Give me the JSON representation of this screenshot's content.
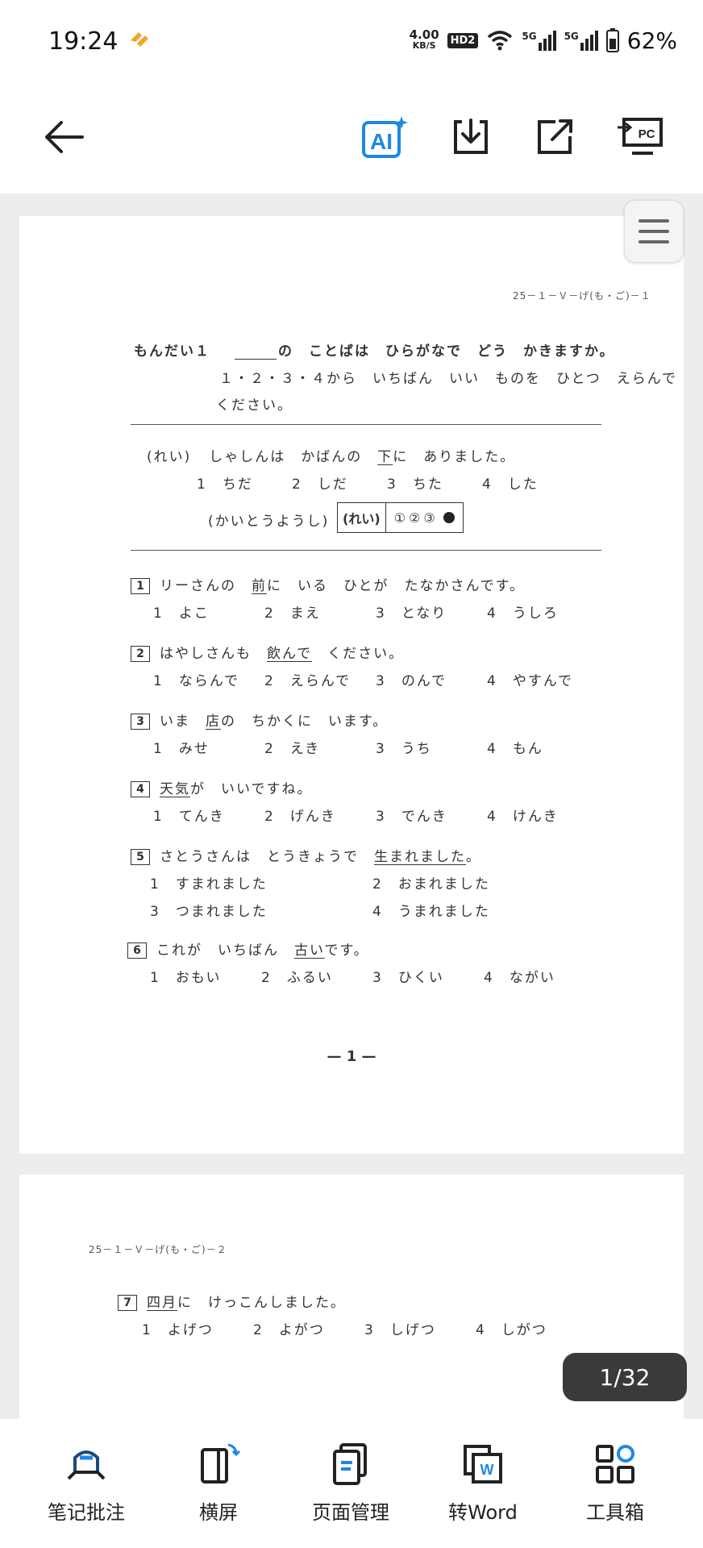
{
  "status_bar": {
    "time": "19:24",
    "speed_value": "4.00",
    "speed_unit": "KB/S",
    "hd_badge": "HD2",
    "network1": "5G",
    "network2": "5G",
    "battery": "62%"
  },
  "toolbar": {
    "back": "back-arrow-icon",
    "ai": "ai-icon",
    "download": "download-icon",
    "share": "share-icon",
    "to_pc": "PC"
  },
  "colors": {
    "accent": "#1e88e5",
    "ai_blue": "#1e88e5",
    "heart": "#f5a623"
  },
  "page1": {
    "code": "25－１－Ｖ－げ(も・ご)－１",
    "header_title": "もんだい１",
    "header_line1": "の　ことばは　ひらがなで　どう　かきますか。",
    "header_line2": "１・２・３・４から　いちばん　いい　ものを　ひとつ　えらんで",
    "header_line3": "ください。",
    "example": {
      "label": "(れい)",
      "sentence_pre": "しゃしんは　かばんの　",
      "sentence_u": "下",
      "sentence_post": "に　ありました。",
      "options": [
        "1　ちだ",
        "2　しだ",
        "3　ちた",
        "4　した"
      ],
      "answer_label": "(かいとうようし)",
      "answer_box_label": "(れい)",
      "answer_circles": "①②③"
    },
    "questions": [
      {
        "num": "1",
        "pre": "リーさんの　",
        "u": "前",
        "post": "に　いる　ひとが　たなかさんです。",
        "options": [
          "1　よこ",
          "2　まえ",
          "3　となり",
          "4　うしろ"
        ]
      },
      {
        "num": "2",
        "pre": "はやしさんも　",
        "u": "飲んで",
        "post": "　ください。",
        "options": [
          "1　ならんで",
          "2　えらんで",
          "3　のんで",
          "4　やすんで"
        ]
      },
      {
        "num": "3",
        "pre": "いま　",
        "u": "店",
        "post": "の　ちかくに　います。",
        "options": [
          "1　みせ",
          "2　えき",
          "3　うち",
          "4　もん"
        ]
      },
      {
        "num": "4",
        "pre": "",
        "u": "天気",
        "post": "が　いいですね。",
        "options": [
          "1　てんき",
          "2　げんき",
          "3　でんき",
          "4　けんき"
        ]
      },
      {
        "num": "5",
        "pre": "さとうさんは　とうきょうで　",
        "u": "生まれました",
        "post": "。",
        "options": [
          "1　すまれました",
          "2　おまれました",
          "3　つまれました",
          "4　うまれました"
        ]
      },
      {
        "num": "6",
        "pre": "これが　いちばん　",
        "u": "古い",
        "post": "です。",
        "options": [
          "1　おもい",
          "2　ふるい",
          "3　ひくい",
          "4　ながい"
        ]
      }
    ],
    "page_number": "— 1 —"
  },
  "page2": {
    "code": "25－１－Ｖ－げ(も・ご)－２",
    "question": {
      "num": "7",
      "pre": "",
      "u": "四月",
      "post": "に　けっこんしました。",
      "options": [
        "1　よげつ",
        "2　よがつ",
        "3　しげつ",
        "4　しがつ"
      ]
    }
  },
  "page_indicator": "1/32",
  "bottom_bar": {
    "items": [
      {
        "label": "笔记批注",
        "icon": "annotate-icon"
      },
      {
        "label": "横屏",
        "icon": "landscape-icon"
      },
      {
        "label": "页面管理",
        "icon": "page-manage-icon"
      },
      {
        "label": "转Word",
        "icon": "word-icon"
      },
      {
        "label": "工具箱",
        "icon": "toolbox-icon"
      }
    ]
  }
}
